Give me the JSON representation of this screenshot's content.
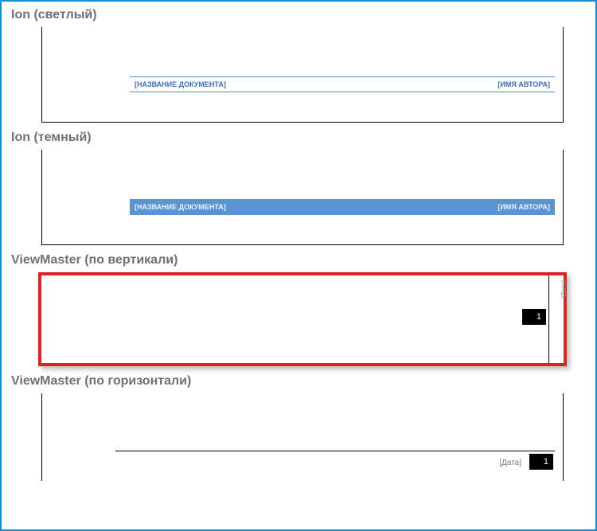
{
  "sections": {
    "ion_light": {
      "title": "Ion (светлый)",
      "doc_label": "[НАЗВАНИЕ ДОКУМЕНТА]",
      "author_label": "[ИМЯ АВТОРА]"
    },
    "ion_dark": {
      "title": "Ion (темный)",
      "doc_label": "[НАЗВАНИЕ ДОКУМЕНТА]",
      "author_label": "[ИМЯ АВТОРА]"
    },
    "vm_vertical": {
      "title": "ViewMaster (по вертикали)",
      "date_label": "[Дата]",
      "page_number": "1"
    },
    "vm_horizontal": {
      "title": "ViewMaster (по горизонтали)",
      "date_label": "[Дата]",
      "page_number": "1"
    }
  }
}
